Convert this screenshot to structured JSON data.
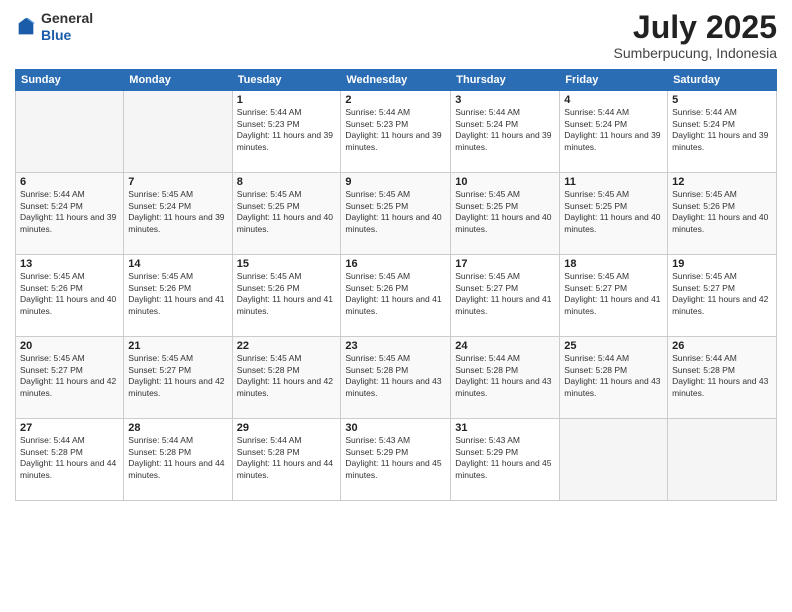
{
  "header": {
    "logo_line1": "General",
    "logo_line2": "Blue",
    "month_year": "July 2025",
    "location": "Sumberpucung, Indonesia"
  },
  "days_of_week": [
    "Sunday",
    "Monday",
    "Tuesday",
    "Wednesday",
    "Thursday",
    "Friday",
    "Saturday"
  ],
  "weeks": [
    [
      {
        "day": "",
        "info": ""
      },
      {
        "day": "",
        "info": ""
      },
      {
        "day": "1",
        "info": "Sunrise: 5:44 AM\nSunset: 5:23 PM\nDaylight: 11 hours and 39 minutes."
      },
      {
        "day": "2",
        "info": "Sunrise: 5:44 AM\nSunset: 5:23 PM\nDaylight: 11 hours and 39 minutes."
      },
      {
        "day": "3",
        "info": "Sunrise: 5:44 AM\nSunset: 5:24 PM\nDaylight: 11 hours and 39 minutes."
      },
      {
        "day": "4",
        "info": "Sunrise: 5:44 AM\nSunset: 5:24 PM\nDaylight: 11 hours and 39 minutes."
      },
      {
        "day": "5",
        "info": "Sunrise: 5:44 AM\nSunset: 5:24 PM\nDaylight: 11 hours and 39 minutes."
      }
    ],
    [
      {
        "day": "6",
        "info": "Sunrise: 5:44 AM\nSunset: 5:24 PM\nDaylight: 11 hours and 39 minutes."
      },
      {
        "day": "7",
        "info": "Sunrise: 5:45 AM\nSunset: 5:24 PM\nDaylight: 11 hours and 39 minutes."
      },
      {
        "day": "8",
        "info": "Sunrise: 5:45 AM\nSunset: 5:25 PM\nDaylight: 11 hours and 40 minutes."
      },
      {
        "day": "9",
        "info": "Sunrise: 5:45 AM\nSunset: 5:25 PM\nDaylight: 11 hours and 40 minutes."
      },
      {
        "day": "10",
        "info": "Sunrise: 5:45 AM\nSunset: 5:25 PM\nDaylight: 11 hours and 40 minutes."
      },
      {
        "day": "11",
        "info": "Sunrise: 5:45 AM\nSunset: 5:25 PM\nDaylight: 11 hours and 40 minutes."
      },
      {
        "day": "12",
        "info": "Sunrise: 5:45 AM\nSunset: 5:26 PM\nDaylight: 11 hours and 40 minutes."
      }
    ],
    [
      {
        "day": "13",
        "info": "Sunrise: 5:45 AM\nSunset: 5:26 PM\nDaylight: 11 hours and 40 minutes."
      },
      {
        "day": "14",
        "info": "Sunrise: 5:45 AM\nSunset: 5:26 PM\nDaylight: 11 hours and 41 minutes."
      },
      {
        "day": "15",
        "info": "Sunrise: 5:45 AM\nSunset: 5:26 PM\nDaylight: 11 hours and 41 minutes."
      },
      {
        "day": "16",
        "info": "Sunrise: 5:45 AM\nSunset: 5:26 PM\nDaylight: 11 hours and 41 minutes."
      },
      {
        "day": "17",
        "info": "Sunrise: 5:45 AM\nSunset: 5:27 PM\nDaylight: 11 hours and 41 minutes."
      },
      {
        "day": "18",
        "info": "Sunrise: 5:45 AM\nSunset: 5:27 PM\nDaylight: 11 hours and 41 minutes."
      },
      {
        "day": "19",
        "info": "Sunrise: 5:45 AM\nSunset: 5:27 PM\nDaylight: 11 hours and 42 minutes."
      }
    ],
    [
      {
        "day": "20",
        "info": "Sunrise: 5:45 AM\nSunset: 5:27 PM\nDaylight: 11 hours and 42 minutes."
      },
      {
        "day": "21",
        "info": "Sunrise: 5:45 AM\nSunset: 5:27 PM\nDaylight: 11 hours and 42 minutes."
      },
      {
        "day": "22",
        "info": "Sunrise: 5:45 AM\nSunset: 5:28 PM\nDaylight: 11 hours and 42 minutes."
      },
      {
        "day": "23",
        "info": "Sunrise: 5:45 AM\nSunset: 5:28 PM\nDaylight: 11 hours and 43 minutes."
      },
      {
        "day": "24",
        "info": "Sunrise: 5:44 AM\nSunset: 5:28 PM\nDaylight: 11 hours and 43 minutes."
      },
      {
        "day": "25",
        "info": "Sunrise: 5:44 AM\nSunset: 5:28 PM\nDaylight: 11 hours and 43 minutes."
      },
      {
        "day": "26",
        "info": "Sunrise: 5:44 AM\nSunset: 5:28 PM\nDaylight: 11 hours and 43 minutes."
      }
    ],
    [
      {
        "day": "27",
        "info": "Sunrise: 5:44 AM\nSunset: 5:28 PM\nDaylight: 11 hours and 44 minutes."
      },
      {
        "day": "28",
        "info": "Sunrise: 5:44 AM\nSunset: 5:28 PM\nDaylight: 11 hours and 44 minutes."
      },
      {
        "day": "29",
        "info": "Sunrise: 5:44 AM\nSunset: 5:28 PM\nDaylight: 11 hours and 44 minutes."
      },
      {
        "day": "30",
        "info": "Sunrise: 5:43 AM\nSunset: 5:29 PM\nDaylight: 11 hours and 45 minutes."
      },
      {
        "day": "31",
        "info": "Sunrise: 5:43 AM\nSunset: 5:29 PM\nDaylight: 11 hours and 45 minutes."
      },
      {
        "day": "",
        "info": ""
      },
      {
        "day": "",
        "info": ""
      }
    ]
  ]
}
